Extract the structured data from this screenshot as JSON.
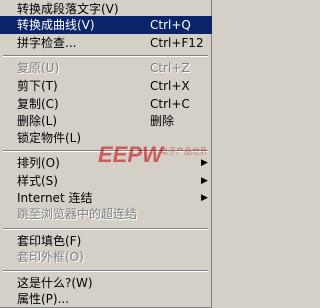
{
  "menu": {
    "items": [
      {
        "label": "转换成段落文字(V)",
        "shortcut": "",
        "disabled": false
      },
      {
        "label": "转换成曲线(V)",
        "shortcut": "Ctrl+Q",
        "selected": true
      },
      {
        "label": "拼字检查...",
        "shortcut": "Ctrl+F12"
      },
      {
        "label": "复原(U)",
        "shortcut": "Ctrl+Z",
        "disabled": true
      },
      {
        "label": "剪下(T)",
        "shortcut": "Ctrl+X"
      },
      {
        "label": "复制(C)",
        "shortcut": "Ctrl+C"
      },
      {
        "label": "删除(L)",
        "shortcut": "删除"
      },
      {
        "label": "锁定物件(L)",
        "shortcut": ""
      },
      {
        "label": "排列(O)",
        "submenu": true
      },
      {
        "label": "样式(S)",
        "submenu": true
      },
      {
        "label": "Internet 连结",
        "submenu": true
      },
      {
        "label": "跳至浏览器中的超连结",
        "disabled": true
      },
      {
        "label": "套印填色(F)"
      },
      {
        "label": "套印外框(O)",
        "disabled": true
      },
      {
        "label": "这是什么?(W)"
      },
      {
        "label": "属性(P)..."
      }
    ],
    "submenu_arrow": "▶"
  },
  "watermark": {
    "logo": "EEPW",
    "tagline": "电子产品世界"
  },
  "colors": {
    "menu_bg": "#d4d0c8",
    "selected_bg": "#0a246a",
    "watermark": "#c00000"
  }
}
